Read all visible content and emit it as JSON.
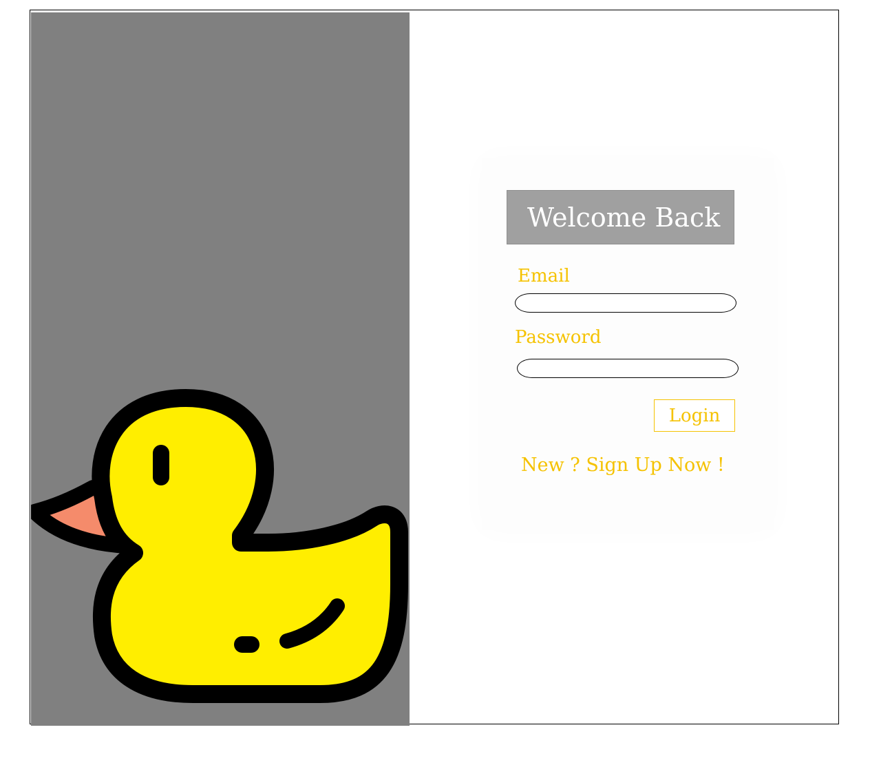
{
  "welcome": {
    "title": "Welcome Back"
  },
  "form": {
    "email_label": "Email",
    "email_value": "",
    "password_label": "Password",
    "password_value": "",
    "login_label": "Login",
    "signup_link": "New ? Sign Up Now !"
  },
  "illustration": {
    "icon": "rubber-duck-icon"
  },
  "colors": {
    "panel": "#808080",
    "accent": "#f5c200",
    "header": "#a0a0a0",
    "duck_body": "#ffee00",
    "duck_beak": "#f58b6b"
  }
}
